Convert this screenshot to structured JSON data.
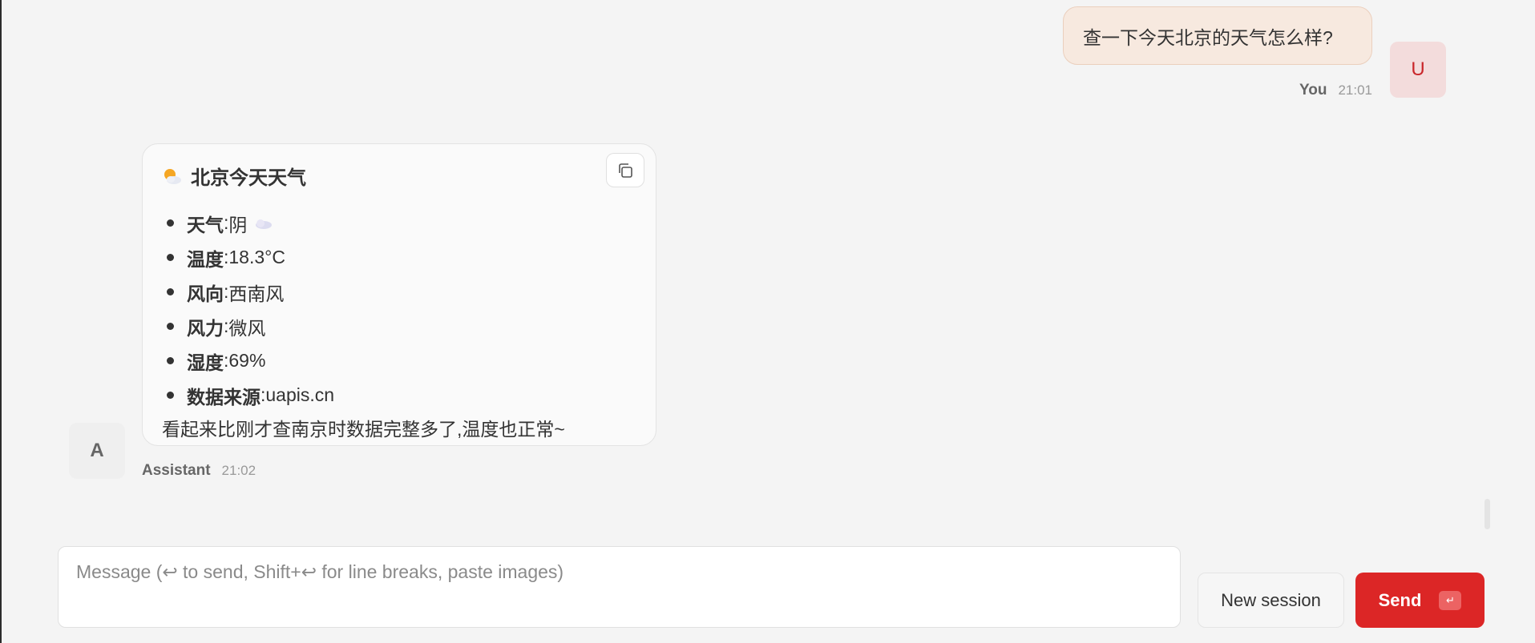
{
  "user_message": {
    "text": "查一下今天北京的天气怎么样?",
    "avatar_letter": "U",
    "sender": "You",
    "time": "21:01"
  },
  "assistant_message": {
    "title": "北京今天天气",
    "title_icon": "sun-behind-cloud-icon",
    "items": [
      {
        "label": "天气",
        "value": "阴",
        "icon": "cloud-icon"
      },
      {
        "label": "温度",
        "value": "18.3°C"
      },
      {
        "label": "风向",
        "value": "西南风"
      },
      {
        "label": "风力",
        "value": "微风"
      },
      {
        "label": "湿度",
        "value": "69%"
      },
      {
        "label": "数据来源",
        "value": "uapis.cn"
      }
    ],
    "separator": ":",
    "followup": "看起来比刚才查南京时数据完整多了,温度也正常~",
    "avatar_letter": "A",
    "sender": "Assistant",
    "time": "21:02"
  },
  "composer": {
    "placeholder": "Message (↩ to send, Shift+↩ for line breaks, paste images)",
    "new_session_label": "New session",
    "send_label": "Send",
    "send_key_glyph": "↵"
  },
  "colors": {
    "accent": "#dc2626",
    "user_bubble": "#f7e9df",
    "user_avatar": "#f3dcdc"
  }
}
